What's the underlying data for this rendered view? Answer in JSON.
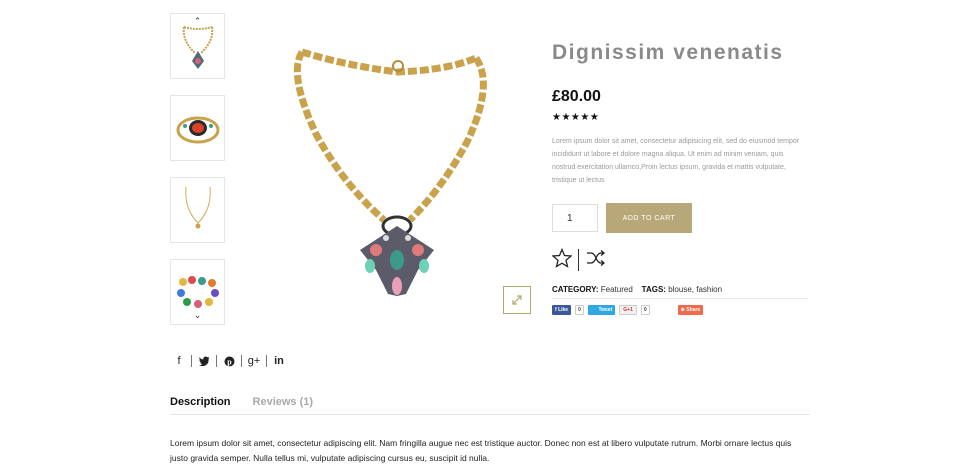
{
  "product": {
    "title": "Dignissim venenatis",
    "price": "£80.00",
    "rating_stars": "★★★★★",
    "rating": 5,
    "short_description": "Lorem ipsum dolor sit amet, consectetur adipisicing elit, sed do eiusmod tempor incididunt ut labore et dolore magna aliqua. Ut enim ad minim veniam, quis nostrud exercitation ullamco,Proin lectus ipsum, gravida et mattis vulputate, tristique ut lectus",
    "quantity": "1",
    "add_to_cart_label": "ADD TO CART",
    "category_label": "CATEGORY:",
    "category_value": "Featured",
    "tags_label": "TAGS:",
    "tags_value": "blouse, fashion"
  },
  "share_widgets": {
    "fb_like": "Like",
    "fb_count": "0",
    "tweet": "Tweet",
    "gplus": "G+1",
    "gplus_count": "0",
    "share": "Share"
  },
  "icons": {
    "wishlist": "star-outline-icon",
    "compare": "shuffle-icon",
    "zoom": "expand-icon",
    "social": [
      "facebook-icon",
      "twitter-icon",
      "pinterest-icon",
      "google-plus-icon",
      "linkedin-icon"
    ]
  },
  "social_glyphs": {
    "facebook": "f",
    "twitter": "🐦",
    "pinterest": "℗",
    "gplus": "g+",
    "linkedin": "in"
  },
  "tabs": [
    {
      "label": "Description",
      "active": true
    },
    {
      "label": "Reviews (1)",
      "active": false
    }
  ],
  "description_text": "Lorem ipsum dolor sit amet, consectetur adipiscing elit. Nam fringilla augue nec est tristique auctor. Donec non est at libero vulputate rutrum. Morbi ornare lectus quis justo gravida semper. Nulla tellus mi, vulputate adipiscing cursus eu, suscipit id nulla.",
  "colors": {
    "accent": "#b8a779",
    "title": "#8a8a8a",
    "facebook": "#3b5998",
    "twitter": "#2ea8e5",
    "share": "#f06a4b"
  }
}
